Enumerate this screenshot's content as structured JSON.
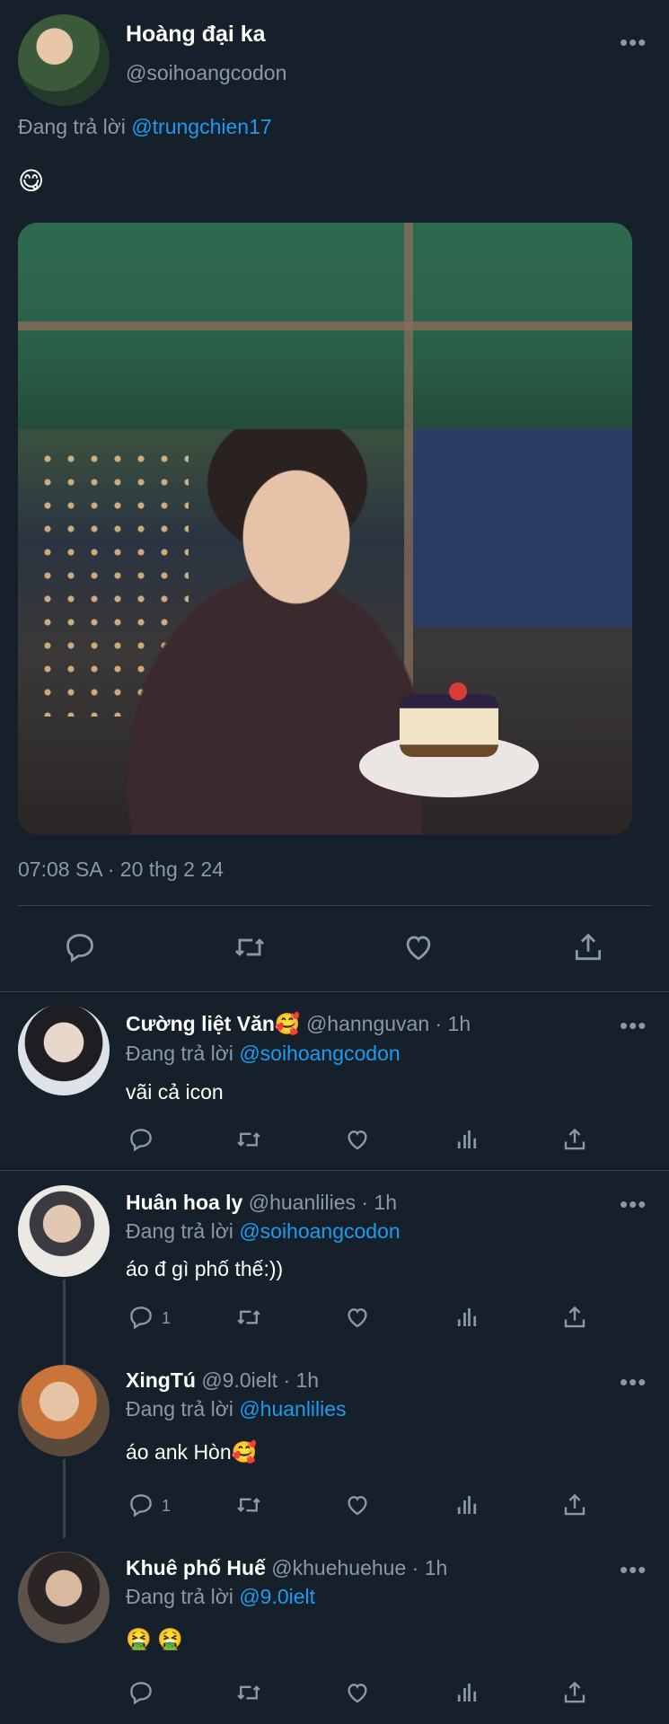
{
  "main": {
    "name": "Hoàng đại ka",
    "handle": "@soihoangcodon",
    "reply_prefix": "Đang trả lời ",
    "reply_to": "@trungchien17",
    "emoji": "😋",
    "timestamp": "07:08 SA · 20 thg 2 24",
    "more": "•••"
  },
  "replies": [
    {
      "name": "Cường liệt Văn🥰",
      "handle": "@hannguvan · 1h",
      "reply_prefix": "Đang trả lời ",
      "reply_to": "@soihoangcodon",
      "text": "vãi cả icon",
      "reply_count": ""
    },
    {
      "name": "Huân hoa ly",
      "handle": "@huanlilies · 1h",
      "reply_prefix": "Đang trả lời ",
      "reply_to": "@soihoangcodon",
      "text": "áo đ gì phố thế:))",
      "reply_count": "1"
    },
    {
      "name": "XingTú",
      "handle": "@9.0ielt · 1h",
      "reply_prefix": "Đang trả lời ",
      "reply_to": "@huanlilies",
      "text": "áo ank Hòn🥰",
      "reply_count": "1"
    },
    {
      "name": "Khuê phố Huế",
      "handle": "@khuehuehue · 1h",
      "reply_prefix": "Đang trả lời ",
      "reply_to": "@9.0ielt",
      "text": "🤮 🤮",
      "reply_count": ""
    }
  ],
  "colors": {
    "background": "#15202b",
    "accent": "#1d9bf0",
    "muted": "#8b98a5",
    "divider": "#38444d"
  }
}
